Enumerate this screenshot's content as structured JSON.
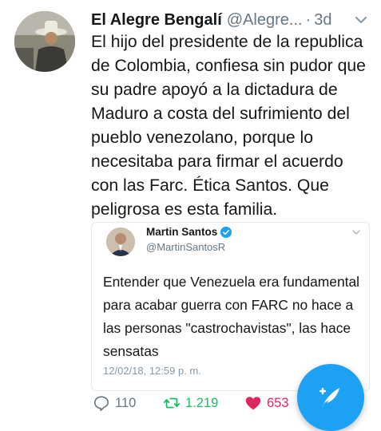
{
  "tweet": {
    "author_name": "El Alegre Bengalí",
    "author_handle": "@Alegre...",
    "separator": "·",
    "time": "3d",
    "text": "El hijo del presidente de la republica de Colombia, confiesa sin pudor que su padre apoyó a la dictadura de Maduro a costa del sufrimiento del pueblo venezolano, porque lo necesitaba para firmar el acuerdo con las Farc. Ética Santos. Que peligrosa es esta familia."
  },
  "quoted_tweet": {
    "author_name": "Martin Santos",
    "author_handle": "@MartinSantosR",
    "text": "Entender que Venezuela era fundamental para acabar guerra con FARC no hace a las personas \"castrochavistas\", las hace sensatas",
    "date": "12/02/18, 12:59 p. m."
  },
  "actions": {
    "reply_count": "110",
    "retweet_count": "1.219",
    "like_count": "653"
  },
  "colors": {
    "accent": "#1da1f2",
    "retweet": "#17bf63",
    "like": "#e0245e",
    "muted": "#657786"
  },
  "icons": {
    "reply": "reply-icon",
    "retweet": "retweet-icon",
    "like": "heart-icon",
    "menu": "chevron-down-icon",
    "verified": "verified-badge-icon",
    "compose": "compose-tweet-icon"
  }
}
